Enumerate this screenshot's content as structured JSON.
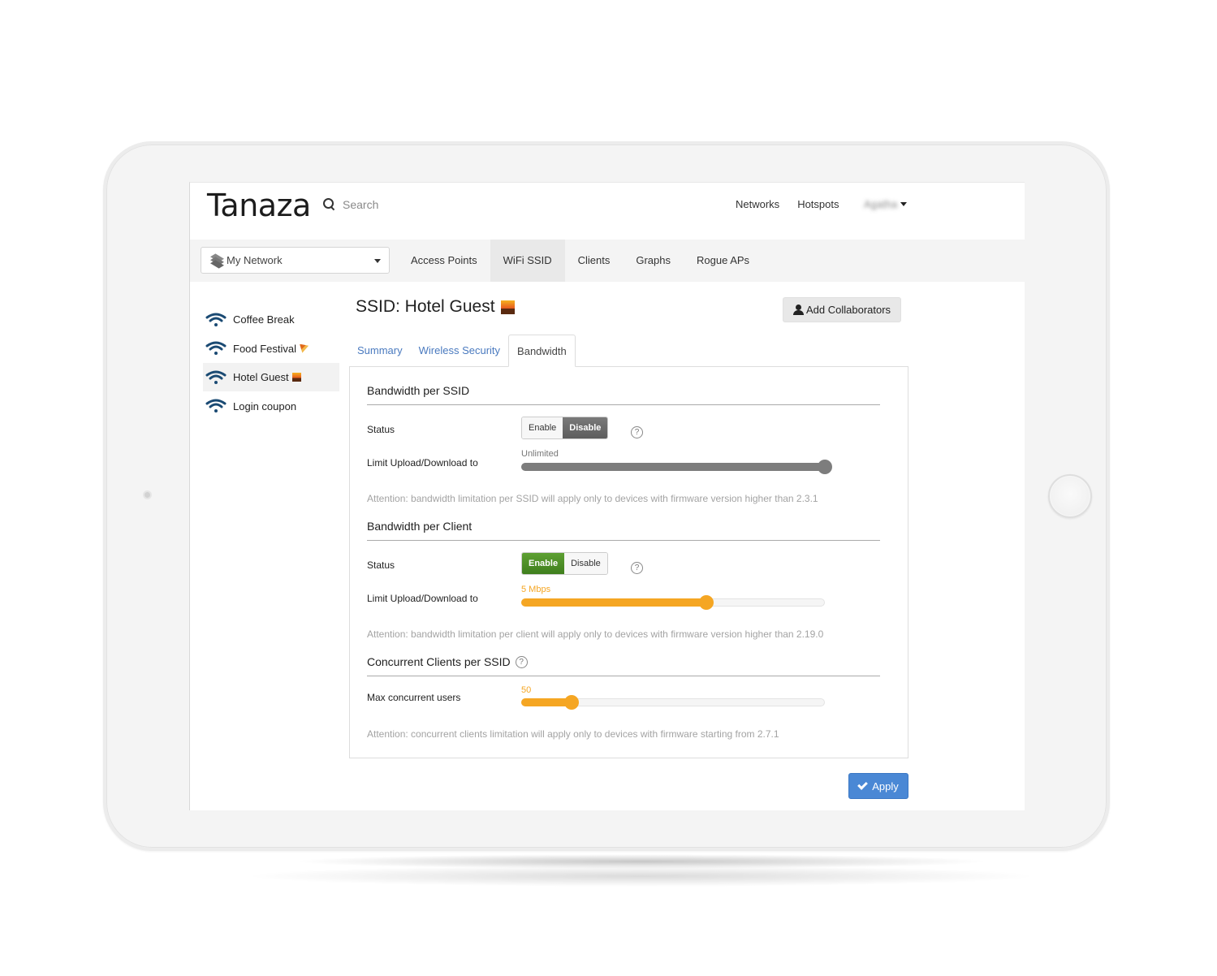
{
  "app": {
    "logo": "Tanaza",
    "search_placeholder": "Search",
    "top_nav": [
      "Networks",
      "Hotspots"
    ],
    "user_name": "Agatha"
  },
  "subnav": {
    "network_selector": "My Network",
    "tabs": [
      {
        "label": "Access Points",
        "active": false
      },
      {
        "label": "WiFi SSID",
        "active": true
      },
      {
        "label": "Clients",
        "active": false
      },
      {
        "label": "Graphs",
        "active": false
      },
      {
        "label": "Rogue APs",
        "active": false
      }
    ]
  },
  "sidebar": {
    "items": [
      {
        "label": "Coffee Break",
        "emoji": "",
        "active": false
      },
      {
        "label": "Food Festival",
        "emoji": "pizza",
        "active": false
      },
      {
        "label": "Hotel Guest",
        "emoji": "sunset",
        "active": true
      },
      {
        "label": "Login coupon",
        "emoji": "",
        "active": false
      }
    ],
    "icon_color": "#1a4a73"
  },
  "main": {
    "title": "SSID: Hotel Guest",
    "add_collaborators_label": "Add Collaborators",
    "tabs": [
      {
        "label": "Summary",
        "active": false
      },
      {
        "label": "Wireless Security",
        "active": false
      },
      {
        "label": "Bandwidth",
        "active": true
      }
    ],
    "sections": {
      "per_ssid": {
        "title": "Bandwidth per SSID",
        "status_label": "Status",
        "enable_label": "Enable",
        "disable_label": "Disable",
        "status": "Disable",
        "limit_label": "Limit Upload/Download to",
        "limit_value_text": "Unlimited",
        "limit_fraction": 1.0,
        "note": "Attention: bandwidth limitation per SSID will apply only to devices with firmware version higher than 2.3.1"
      },
      "per_client": {
        "title": "Bandwidth per Client",
        "status_label": "Status",
        "enable_label": "Enable",
        "disable_label": "Disable",
        "status": "Enable",
        "limit_label": "Limit Upload/Download to",
        "limit_value_text": "5 Mbps",
        "limit_fraction": 0.61,
        "note": "Attention: bandwidth limitation per client will apply only to devices with firmware version higher than 2.19.0"
      },
      "concurrent": {
        "title": "Concurrent Clients per SSID",
        "max_label": "Max concurrent users",
        "max_value_text": "50",
        "max_fraction": 0.165,
        "note": "Attention: concurrent clients limitation will apply only to devices with firmware starting from 2.7.1"
      }
    },
    "apply_label": "Apply",
    "help_glyph": "?"
  },
  "colors": {
    "accent_orange": "#f5a623",
    "enable_green": "#4a8c26",
    "apply_blue": "#4a88d5",
    "link_blue": "#4a7abf"
  }
}
